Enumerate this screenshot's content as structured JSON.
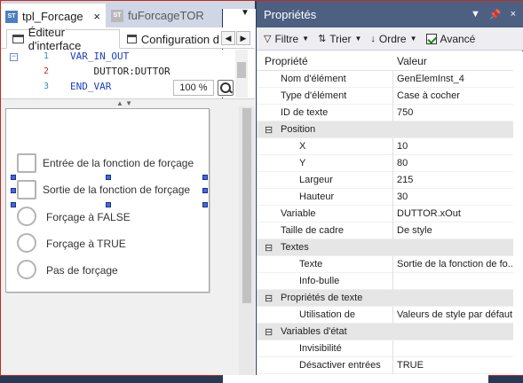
{
  "doc_tabs": {
    "active": {
      "badge": "ST",
      "label": "tpl_Forcage",
      "close": "×"
    },
    "inactive": {
      "badge": "ST",
      "label": "fuForcageTOR"
    },
    "right_badge": "ST",
    "dropdown": "▼"
  },
  "sub_tabs": {
    "active_label": "Éditeur d'interface",
    "inactive_label": "Configuration d",
    "prev": "◀",
    "next": "▶"
  },
  "code": {
    "lines": [
      {
        "num": "1",
        "text": "VAR_IN_OUT",
        "keyword": true
      },
      {
        "num": "2",
        "text": "    DUTTOR:DUTTOR",
        "keyword": false
      },
      {
        "num": "3",
        "text": "END_VAR",
        "keyword": true
      }
    ],
    "fold": "−",
    "zoom": "100 %"
  },
  "splitter_arrows": "▲ ▼",
  "visu": {
    "checkboxes": [
      {
        "label": "Entrée de la fonction de forçage"
      },
      {
        "label": "Sortie de la fonction de forçage"
      }
    ],
    "radios": [
      {
        "label": "Forçage à FALSE"
      },
      {
        "label": "Forçage à TRUE"
      },
      {
        "label": "Pas de forçage"
      }
    ]
  },
  "properties_panel": {
    "title": "Propriétés",
    "title_buttons": [
      "▼",
      "📌",
      "×"
    ],
    "toolbar": {
      "filter": "Filtre",
      "sort": "Trier",
      "order": "Ordre",
      "advanced": "Avancé",
      "advanced_checked": true
    },
    "columns": {
      "property": "Propriété",
      "value": "Valeur"
    },
    "rows": [
      {
        "type": "prop",
        "indent": 1,
        "name": "Nom d'élément",
        "value": "GenElemInst_4"
      },
      {
        "type": "prop",
        "indent": 1,
        "name": "Type d'élément",
        "value": "Case à cocher"
      },
      {
        "type": "prop",
        "indent": 1,
        "name": "ID de texte",
        "value": "750"
      },
      {
        "type": "cat",
        "indent": 1,
        "name": "Position",
        "value": ""
      },
      {
        "type": "prop",
        "indent": 2,
        "name": "X",
        "value": "10"
      },
      {
        "type": "prop",
        "indent": 2,
        "name": "Y",
        "value": "80"
      },
      {
        "type": "prop",
        "indent": 2,
        "name": "Largeur",
        "value": "215"
      },
      {
        "type": "prop",
        "indent": 2,
        "name": "Hauteur",
        "value": "30"
      },
      {
        "type": "prop",
        "indent": 1,
        "name": "Variable",
        "value": "DUTTOR.xOut"
      },
      {
        "type": "prop",
        "indent": 1,
        "name": "Taille de cadre",
        "value": "De style"
      },
      {
        "type": "cat",
        "indent": 1,
        "name": "Textes",
        "value": ""
      },
      {
        "type": "prop",
        "indent": 2,
        "name": "Texte",
        "value": "Sortie de la fonction de fo..."
      },
      {
        "type": "prop",
        "indent": 2,
        "name": "Info-bulle",
        "value": ""
      },
      {
        "type": "cat",
        "indent": 1,
        "name": "Propriétés de texte",
        "value": ""
      },
      {
        "type": "prop",
        "indent": 2,
        "name": "Utilisation de",
        "value": "Valeurs de style par défaut"
      },
      {
        "type": "cat",
        "indent": 1,
        "name": "Variables d'état",
        "value": ""
      },
      {
        "type": "prop",
        "indent": 2,
        "name": "Invisibilité",
        "value": ""
      },
      {
        "type": "prop",
        "indent": 2,
        "name": "Désactiver entrées",
        "value": "TRUE"
      }
    ]
  }
}
